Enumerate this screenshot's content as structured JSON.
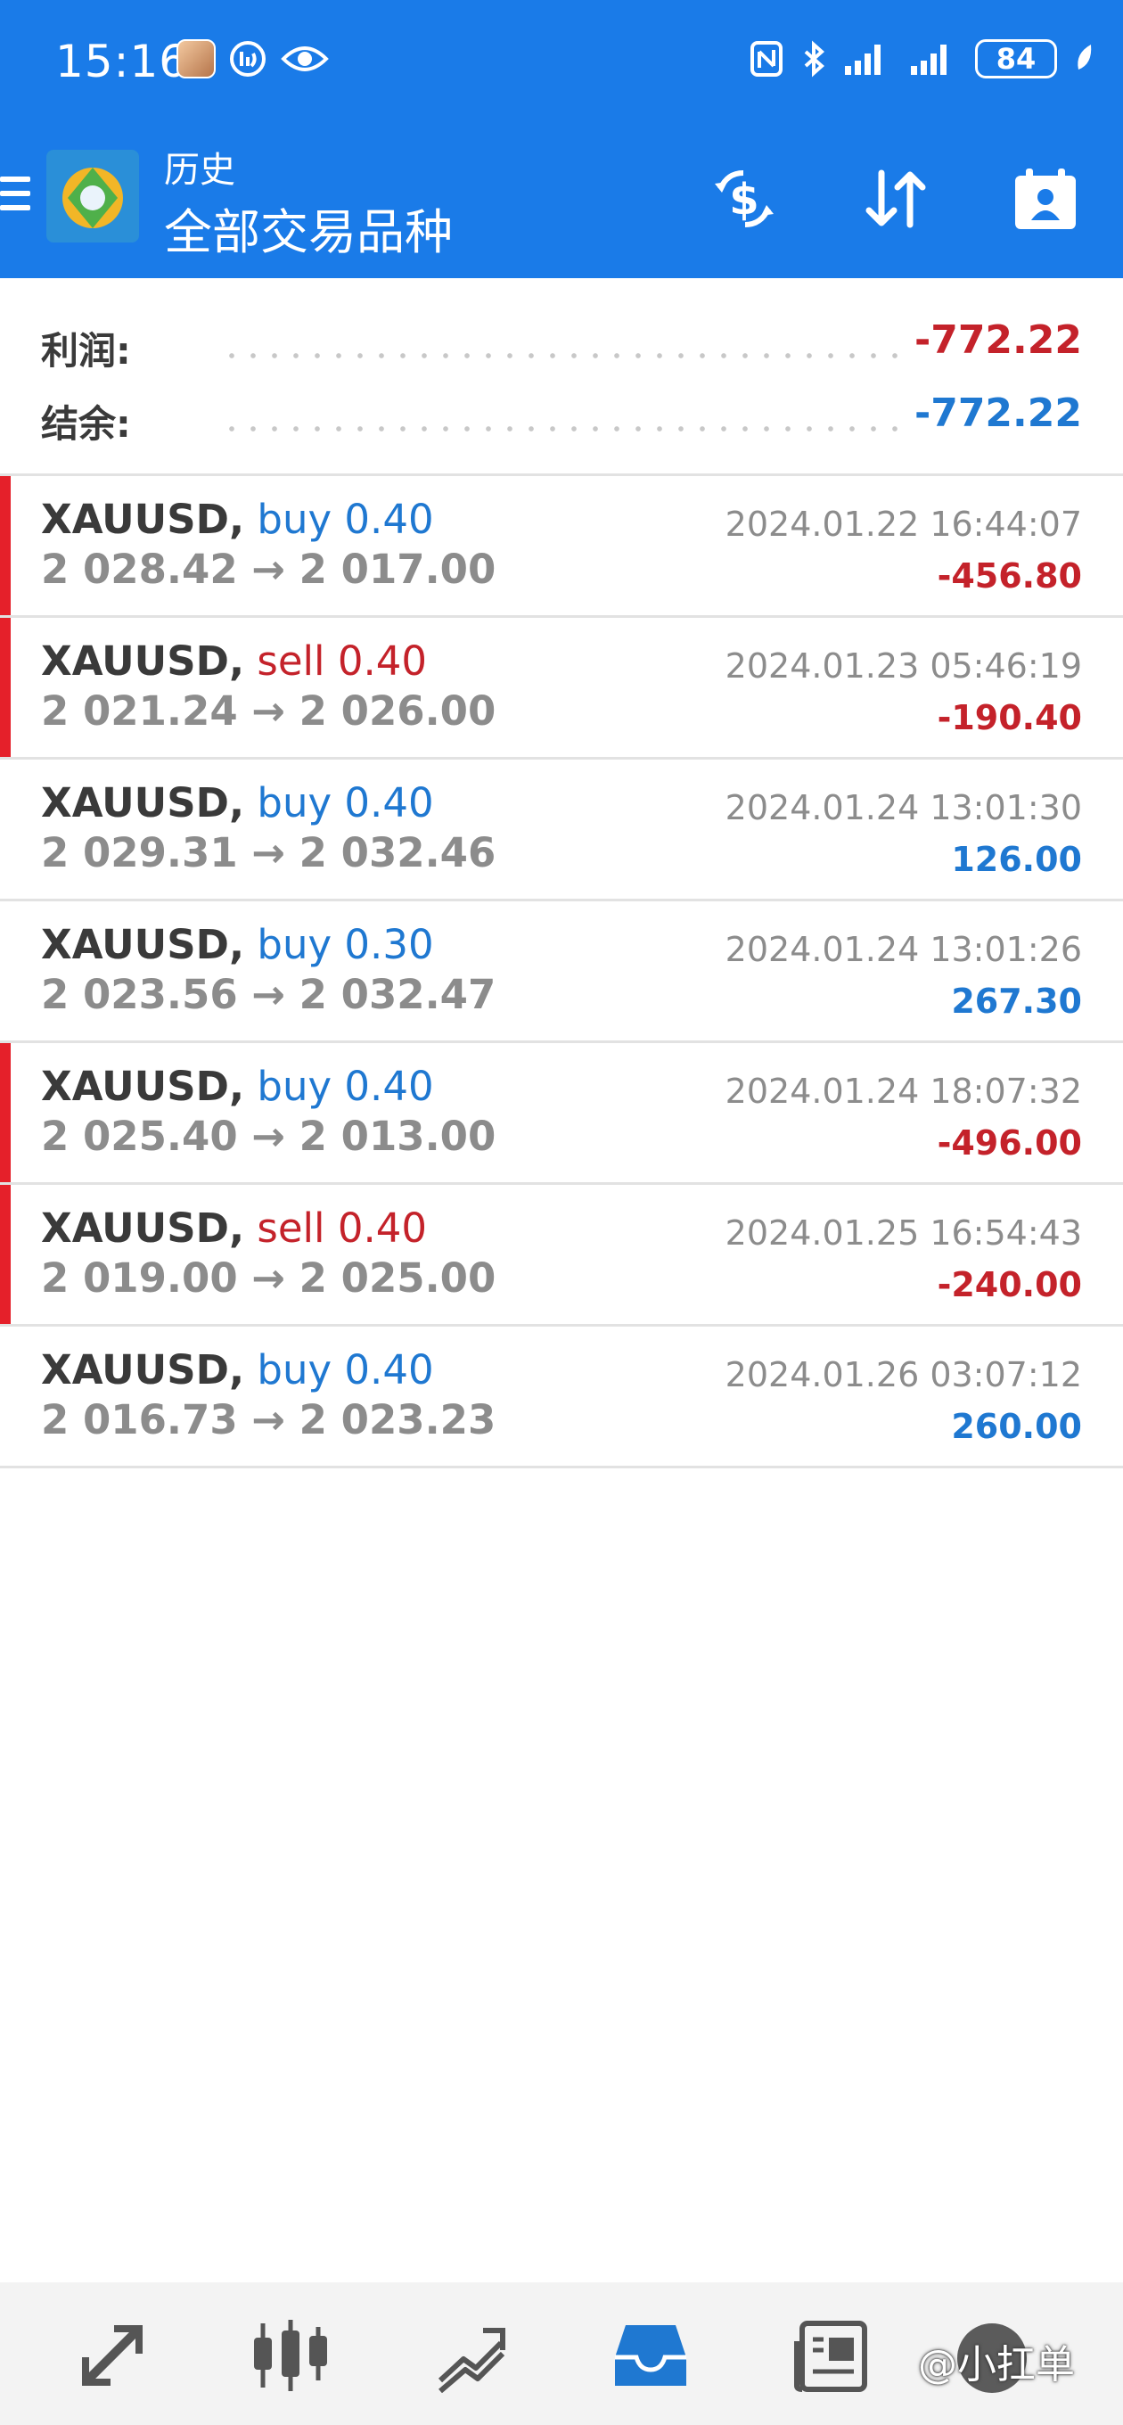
{
  "status_bar": {
    "time": "15:16",
    "battery": "84"
  },
  "app_bar": {
    "subtitle": "历史",
    "title": "全部交易品种"
  },
  "summary": {
    "profit_label": "利润:",
    "profit_value": "-772.22",
    "balance_label": "结余:",
    "balance_value": "-772.22"
  },
  "colors": {
    "accent": "#1a7be8",
    "buy": "#1f78d1",
    "sell": "#c4222a",
    "loss": "#c4222a",
    "gain": "#1f78d1"
  },
  "trades": [
    {
      "symbol": "XAUUSD,",
      "side": "buy 0.40",
      "prices": "2 028.42 → 2 017.00",
      "datetime": "2024.01.22 16:44:07",
      "profit": "-456.80"
    },
    {
      "symbol": "XAUUSD,",
      "side": "sell 0.40",
      "prices": "2 021.24 → 2 026.00",
      "datetime": "2024.01.23 05:46:19",
      "profit": "-190.40"
    },
    {
      "symbol": "XAUUSD,",
      "side": "buy 0.40",
      "prices": "2 029.31 → 2 032.46",
      "datetime": "2024.01.24 13:01:30",
      "profit": "126.00"
    },
    {
      "symbol": "XAUUSD,",
      "side": "buy 0.30",
      "prices": "2 023.56 → 2 032.47",
      "datetime": "2024.01.24 13:01:26",
      "profit": "267.30"
    },
    {
      "symbol": "XAUUSD,",
      "side": "buy 0.40",
      "prices": "2 025.40 → 2 013.00",
      "datetime": "2024.01.24 18:07:32",
      "profit": "-496.00"
    },
    {
      "symbol": "XAUUSD,",
      "side": "sell 0.40",
      "prices": "2 019.00 → 2 025.00",
      "datetime": "2024.01.25 16:54:43",
      "profit": "-240.00"
    },
    {
      "symbol": "XAUUSD,",
      "side": "buy 0.40",
      "prices": "2 016.73 → 2 023.23",
      "datetime": "2024.01.26 03:07:12",
      "profit": "260.00"
    }
  ],
  "bottom_nav": {
    "items": [
      "quotes-icon",
      "chart-icon",
      "trade-icon",
      "history-icon",
      "news-icon"
    ],
    "active": "history-icon",
    "watermark": "@小扛单"
  }
}
